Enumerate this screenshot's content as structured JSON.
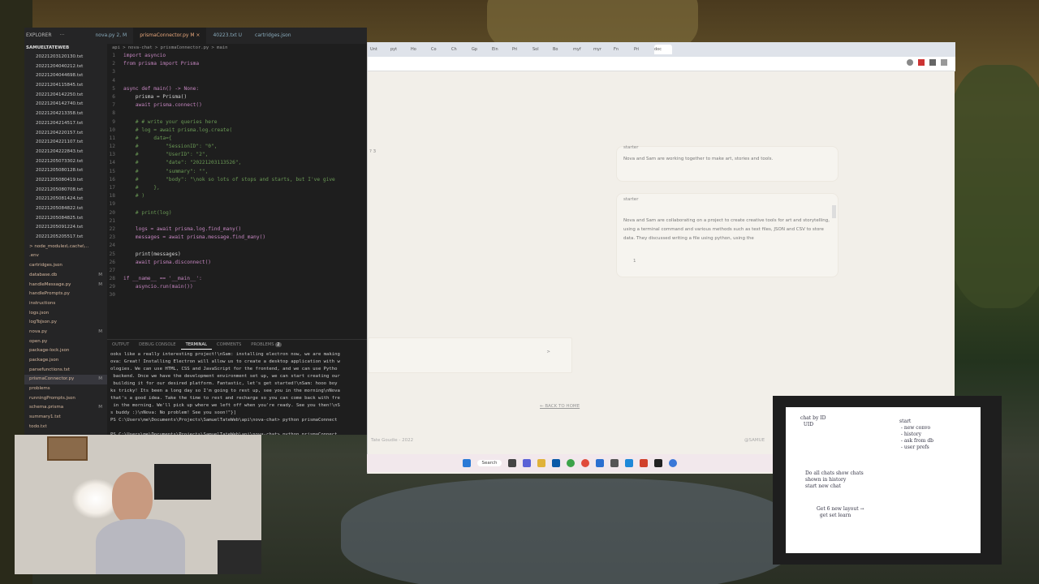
{
  "vscode": {
    "explorer_title": "EXPLORER",
    "ellipsis": "···",
    "workspace": "SAMUELTATEWEB",
    "tabs": [
      "nova.py 2, M",
      "prismaConnector.py M ×",
      "40223.txt U",
      "cartridges.json"
    ],
    "breadcrumb": "api > nova-chat > prismaConnector.py > main",
    "files": [
      {
        "name": "20221203120130.txt",
        "folder": false
      },
      {
        "name": "20221204040212.txt",
        "folder": false
      },
      {
        "name": "20221204044698.txt",
        "folder": false
      },
      {
        "name": "20221204115845.txt",
        "folder": false
      },
      {
        "name": "20221204142250.txt",
        "folder": false
      },
      {
        "name": "20221204142740.txt",
        "folder": false
      },
      {
        "name": "20221204213358.txt",
        "folder": false
      },
      {
        "name": "20221204214517.txt",
        "folder": false
      },
      {
        "name": "20221204220157.txt",
        "folder": false
      },
      {
        "name": "20221204221107.txt",
        "folder": false
      },
      {
        "name": "20221204222843.txt",
        "folder": false
      },
      {
        "name": "20221205073302.txt",
        "folder": false
      },
      {
        "name": "20221205080128.txt",
        "folder": false
      },
      {
        "name": "20221205080419.txt",
        "folder": false
      },
      {
        "name": "20221205080708.txt",
        "folder": false
      },
      {
        "name": "20221205081424.txt",
        "folder": false
      },
      {
        "name": "20221205084822.txt",
        "folder": false
      },
      {
        "name": "20221205084825.txt",
        "folder": false
      },
      {
        "name": "20221205091224.txt",
        "folder": false
      },
      {
        "name": "20221205205517.txt",
        "folder": false
      },
      {
        "name": "> node_modules\\.cache\\...",
        "folder": true
      },
      {
        "name": ".env",
        "folder": true
      },
      {
        "name": "cartridges.json",
        "folder": true
      },
      {
        "name": "database.db",
        "folder": true,
        "mark": "M"
      },
      {
        "name": "handleMessage.py",
        "folder": true,
        "mark": "M"
      },
      {
        "name": "handlePrompts.py",
        "folder": true
      },
      {
        "name": "instructions",
        "folder": true
      },
      {
        "name": "logs.json",
        "folder": true
      },
      {
        "name": "logToJson.py",
        "folder": true
      },
      {
        "name": "nova.py",
        "folder": true,
        "mark": "M"
      },
      {
        "name": "open.py",
        "folder": true
      },
      {
        "name": "package-lock.json",
        "folder": true
      },
      {
        "name": "package.json",
        "folder": true
      },
      {
        "name": "parsefunctions.txt",
        "folder": true
      },
      {
        "name": "prismaConnector.py",
        "folder": true,
        "mark": "M",
        "sel": true
      },
      {
        "name": "problems",
        "folder": true
      },
      {
        "name": "runningPrompts.json",
        "folder": true
      },
      {
        "name": "schema.prisma",
        "folder": true,
        "mark": "M"
      },
      {
        "name": "summary1.txt",
        "folder": true
      },
      {
        "name": "todo.txt",
        "folder": true
      }
    ],
    "code": [
      "import asyncio",
      "from prisma import Prisma",
      "",
      "",
      "async def main() -> None:",
      "    prisma = Prisma()",
      "    await prisma.connect()",
      "",
      "    # # write your queries here",
      "    # log = await prisma.log.create(",
      "    #     data={",
      "    #         \"SessionID\": \"0\",",
      "    #         \"UserID\": \"2\",",
      "    #         \"date\": \"20221203113526\",",
      "    #         \"summary\": \"\",",
      "    #         \"body\": \"\\nok so lots of stops and starts, but I've give",
      "    #     },",
      "    # )",
      "",
      "    # print(log)",
      "",
      "    logs = await prisma.log.find_many()",
      "    messages = await prisma.message.find_many()",
      "",
      "    print(messages)",
      "    await prisma.disconnect()",
      "",
      "if __name__ == '__main__':",
      "    asyncio.run(main())",
      ""
    ],
    "panel_tabs": [
      "OUTPUT",
      "DEBUG CONSOLE",
      "TERMINAL",
      "COMMENTS",
      "PROBLEMS"
    ],
    "problems_count": "2",
    "terminal": [
      "ooks like a really interesting project!\\nSam: installing electron now, we are making",
      "ova: Great! Installing Electron will allow us to create a desktop application with w",
      "ologies. We can use HTML, CSS and JavaScript for the frontend, and we can use Pytho",
      " backend. Once we have the development environment set up, we can start creating our",
      " building it for our desired platform. Fantastic, let's get started!\\nSam: hooo boy",
      "ks tricky! Its been a long day so I'm going to rest up, see you in the morning\\nNova",
      "that's a good idea. Take the time to rest and recharge so you can come back with fre",
      " in the morning. We'll pick up where we left off when you're ready. See you then!\\nS",
      "s buddy :)\\nNova: No problem! See you soon!\"}]",
      "PS C:\\Users\\me\\Documents\\Projects\\SamuelTateWeb\\api\\nova-chat> python prismaConnect",
      "",
      "PS C:\\Users\\me\\Documents\\Projects\\SamuelTateWeb\\api\\nova-chat> python prismaConnect",
      "",
      "PS C:\\Users\\me\\Documents\\Projects\\SamuelTateWeb\\api\\nova-chat> python prismaConnect",
      "",
      "PS C:\\Users\\me\\Documents\\Projects\\SamuelTateWeb\\api\\nova-chat> "
    ]
  },
  "browser": {
    "tabs": [
      "Unt",
      "pyt",
      "Ho",
      "Co",
      "Ch",
      "Gp",
      "Ein",
      "Pri",
      "Sol",
      "Bo",
      "myf",
      "myr",
      "Fn",
      "Pri",
      "doc"
    ],
    "fragment": "? 3",
    "messages": [
      {
        "role": "starter",
        "text": "Nova and Sam are working together to make art, stories and tools."
      },
      {
        "role": "starter",
        "text": "Nova and Sam are collaborating on a project to create creative tools for art and storytelling, using a terminal command and various methods such as text files, JSON and CSV to store data. They discussed writing a file using python, using the",
        "counter": "1"
      }
    ],
    "send_glyph": ">",
    "back_link": "← BACK TO HOME",
    "footer_left": "Tate Goudie - 2022",
    "footer_right": "@SAMUE"
  },
  "taskbar": {
    "search": "Search"
  },
  "notes": {
    "col1": "chat by ID\n  UID",
    "col2": "start\n - new convo\n - history\n - ask from db\n - user prefs",
    "col3": "Do all chats show chats\nshown in history\nstart new chat",
    "col4": "Get 6 new layout →\n  get set learn"
  }
}
